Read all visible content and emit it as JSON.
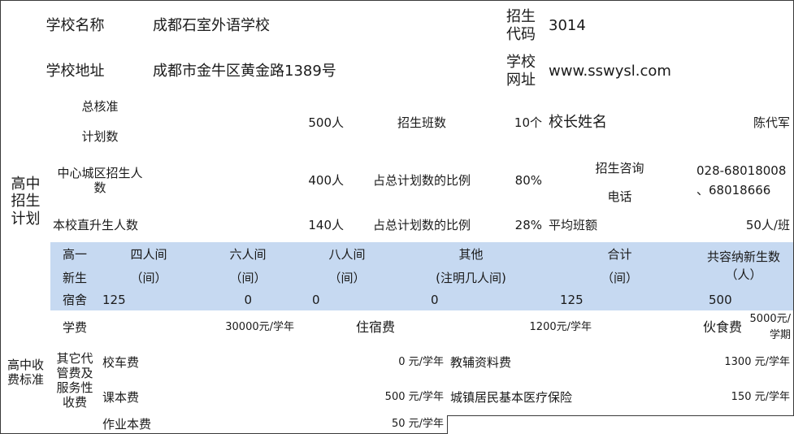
{
  "school": {
    "name_label": "学校名称",
    "name": "成都石室外语学校",
    "code_label_1": "招生",
    "code_label_2": "代码",
    "code": "3014",
    "address_label": "学校地址",
    "address": "成都市金牛区黄金路1389号",
    "site_label_1": "学校",
    "site_label_2": "网址",
    "site": "www.sswysl.com"
  },
  "plan": {
    "section_label_1": "高中",
    "section_label_2": "招生",
    "section_label_3": "计划",
    "total_label_1": "总核准",
    "total_label_2": "计划数",
    "total_value": "500人",
    "classes_label": "招生班数",
    "classes_value": "10个",
    "principal_label": "校长姓名",
    "principal_value": "陈代军",
    "central_label": "中心城区招生人数",
    "central_value": "400人",
    "ratio_label": "占总计划数的比例",
    "central_ratio": "80%",
    "consult_label_1": "招生咨询",
    "consult_label_2": "电话",
    "phone_1": "028-68018008",
    "phone_2": "、68018666",
    "direct_label": "本校直升生人数",
    "direct_value": "140人",
    "direct_ratio": "28%",
    "avg_label": "平均班额",
    "avg_value": "50人/班"
  },
  "dorm": {
    "row_labels": [
      "高一",
      "新生",
      "宿舍"
    ],
    "headers": [
      {
        "top": "四人间",
        "sub": "（间）"
      },
      {
        "top": "六人间",
        "sub": "（间）"
      },
      {
        "top": "八人间",
        "sub": "（间）"
      },
      {
        "top": "其他",
        "sub": "(注明几人间)"
      },
      {
        "top": "合计",
        "sub": "（间）"
      }
    ],
    "capacity_label_1": "共容纳新生数",
    "capacity_label_2": "（人）",
    "values": [
      "125",
      "0",
      "0",
      "0",
      "125"
    ],
    "capacity_value": "500"
  },
  "fees": {
    "section_label": "高中收费标准",
    "tuition_label": "学费",
    "tuition_value": "30000元/学年",
    "lodging_label": "住宿费",
    "lodging_value": "1200元/学年",
    "meal_label": "伙食费",
    "meal_value_1": "5000元/",
    "meal_value_2": "学期",
    "other_label": "其它代管费及服务性收费",
    "items": [
      {
        "label": "校车费",
        "value": "0 元/学年"
      },
      {
        "label": "教辅资料费",
        "value": "1300 元/学年"
      },
      {
        "label": "课本费",
        "value": "500 元/学年"
      },
      {
        "label": "城镇居民基本医疗保险",
        "value": "150 元/学年"
      },
      {
        "label": "作业本费",
        "value": "50 元/学年"
      }
    ]
  }
}
